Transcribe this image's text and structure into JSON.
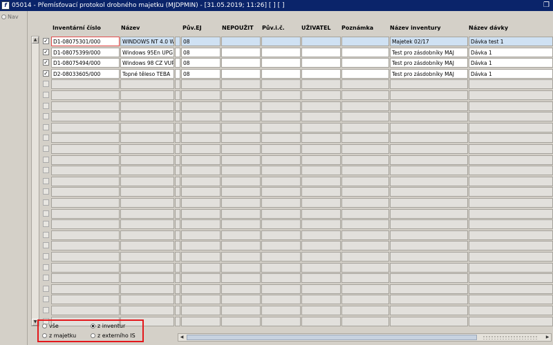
{
  "window": {
    "title": "05014 - Přemísťovací protokol drobného majetku (MJDPMIN) - [31.05.2019; 11:26]  [ ]  [ ]",
    "app_icon": "app-logo-icon",
    "restore_icon": "restore-window-icon"
  },
  "nav": {
    "label": "Nav"
  },
  "columns": {
    "inventarni_cislo": "Inventární číslo",
    "nazev": "Název",
    "puv_ej": "Pův.EJ",
    "nepouzit": "NEPOUŽIT",
    "puv_ic": "Pův.i.č.",
    "uzivatel": "UŽIVATEL",
    "poznamka": "Poznámka",
    "nazev_inventury": "Název inventury",
    "nazev_davky": "Název dávky"
  },
  "rows": [
    {
      "checked": true,
      "inv": "D1-08075301/000",
      "nazev": "WINDOWS NT 4.0 WC",
      "puv_ej": "08",
      "nazev_inventury": "Majetek 02/17",
      "nazev_davky": "Dávka test 1"
    },
    {
      "checked": true,
      "inv": "D1-08075399/000",
      "nazev": "Windows 95En UPG",
      "puv_ej": "08",
      "nazev_inventury": "Test pro zásdobníky MAJ",
      "nazev_davky": "Dávka 1"
    },
    {
      "checked": true,
      "inv": "D1-08075494/000",
      "nazev": "Windows 98 CZ VUP",
      "puv_ej": "08",
      "nazev_inventury": "Test pro zásdobníky MAJ",
      "nazev_davky": "Dávka 1"
    },
    {
      "checked": true,
      "inv": "D2-08033605/000",
      "nazev": "Topné těleso TEBA",
      "puv_ej": "08",
      "nazev_inventury": "Test pro zásdobníky MAJ",
      "nazev_davky": "Dávka 1"
    }
  ],
  "empty_row_count": 23,
  "filters": {
    "vse": "vše",
    "z_inventur": "z inventur",
    "z_majetku": "z majetku",
    "z_externiho": "z externího IS",
    "selected": "z inventur"
  },
  "colors": {
    "title_bar": "#0a246a",
    "highlight_border": "#e3161a",
    "selected_row": "#cfe1f3"
  }
}
